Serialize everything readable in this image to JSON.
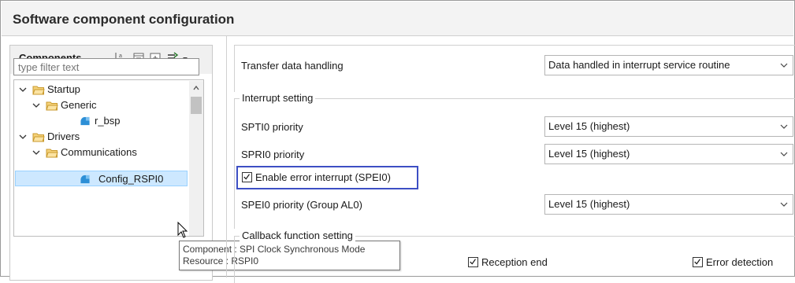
{
  "window": {
    "title": "Software component configuration"
  },
  "components_panel": {
    "title": "Components",
    "filter_placeholder": "type filter text",
    "tree": [
      {
        "label": "Startup",
        "level": 0,
        "type": "folder",
        "expanded": true
      },
      {
        "label": "Generic",
        "level": 1,
        "type": "folder",
        "expanded": true
      },
      {
        "label": "r_bsp",
        "level": 2,
        "type": "component"
      },
      {
        "label": "Drivers",
        "level": 0,
        "type": "folder",
        "expanded": true
      },
      {
        "label": "Communications",
        "level": 1,
        "type": "folder",
        "expanded": true
      },
      {
        "label": "Config_RSPI0",
        "level": 2,
        "type": "component",
        "selected": true
      }
    ],
    "tooltip": {
      "line1": "Component : SPI Clock Synchronous Mode",
      "line2": "Resource : RSPI0"
    }
  },
  "properties": {
    "transfer_data_handling": {
      "label": "Transfer data handling",
      "value": "Data handled in interrupt service routine"
    },
    "interrupt_setting": {
      "title": "Interrupt setting",
      "spti0_priority": {
        "label": "SPTI0 priority",
        "value": "Level 15 (highest)"
      },
      "spri0_priority": {
        "label": "SPRI0 priority",
        "value": "Level 15 (highest)"
      },
      "enable_error_interrupt": {
        "label": "Enable error interrupt (SPEI0)",
        "checked": true
      },
      "spei0_priority": {
        "label": "SPEI0 priority (Group AL0)",
        "value": "Level 15 (highest)"
      }
    },
    "callback_setting": {
      "title": "Callback function setting",
      "reception_end": {
        "label": "Reception end",
        "checked": true
      },
      "error_detection": {
        "label": "Error detection",
        "checked": true
      }
    }
  },
  "colors": {
    "highlight_border": "#3d4fc4",
    "selection_bg": "#cde8ff",
    "folder_fill": "#f5d27a"
  }
}
